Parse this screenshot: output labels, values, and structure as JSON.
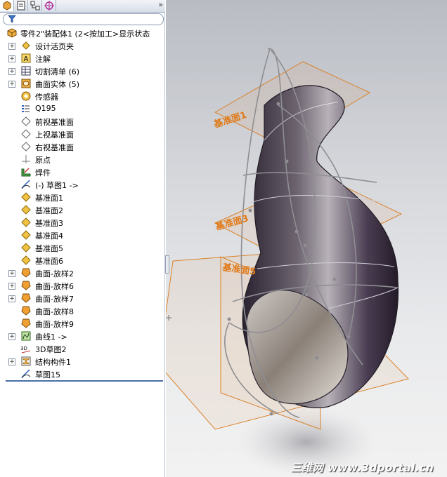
{
  "tabs": [
    "feature-manager-icon",
    "property-manager-icon",
    "configuration-manager-icon",
    "dimxpert-icon"
  ],
  "tab_more": "»",
  "tree": {
    "root_label": "零件2\"装配体1    (2<按加工>显示状态",
    "items": [
      {
        "label": "设计活页夹",
        "icon": "design-binder-icon",
        "expandable": true
      },
      {
        "label": "注解",
        "icon": "annotations-icon",
        "expandable": true
      },
      {
        "label": "切割清单 (6)",
        "icon": "cut-list-icon",
        "expandable": true
      },
      {
        "label": "曲面实体 (5)",
        "icon": "surface-bodies-icon",
        "expandable": true
      },
      {
        "label": "传感器",
        "icon": "sensor-icon",
        "expandable": false
      },
      {
        "label": "Q195",
        "icon": "material-icon",
        "expandable": false
      },
      {
        "label": "前视基准面",
        "icon": "plane-icon",
        "expandable": false
      },
      {
        "label": "上视基准面",
        "icon": "plane-icon",
        "expandable": false
      },
      {
        "label": "右视基准面",
        "icon": "plane-icon",
        "expandable": false
      },
      {
        "label": "原点",
        "icon": "origin-icon",
        "expandable": false
      },
      {
        "label": "焊件",
        "icon": "weldment-icon",
        "expandable": false
      },
      {
        "label": "(-) 草图1 ->",
        "icon": "sketch-icon",
        "expandable": false
      },
      {
        "label": "基准面1",
        "icon": "ref-plane-icon",
        "expandable": false
      },
      {
        "label": "基准面2",
        "icon": "ref-plane-icon",
        "expandable": false
      },
      {
        "label": "基准面3",
        "icon": "ref-plane-icon",
        "expandable": false
      },
      {
        "label": "基准面4",
        "icon": "ref-plane-icon",
        "expandable": false
      },
      {
        "label": "基准面5",
        "icon": "ref-plane-icon",
        "expandable": false
      },
      {
        "label": "基准面6",
        "icon": "ref-plane-icon",
        "expandable": false
      },
      {
        "label": "曲面-放样2",
        "icon": "loft-icon",
        "expandable": true
      },
      {
        "label": "曲面-放样6",
        "icon": "loft-icon",
        "expandable": true
      },
      {
        "label": "曲面-放样7",
        "icon": "loft-icon",
        "expandable": true
      },
      {
        "label": "曲面-放样8",
        "icon": "loft-icon",
        "expandable": false
      },
      {
        "label": "曲面-放样9",
        "icon": "loft-icon",
        "expandable": false
      },
      {
        "label": "曲线1 ->",
        "icon": "curve-icon",
        "expandable": true
      },
      {
        "label": "3D草图2",
        "icon": "3d-sketch-icon",
        "expandable": false
      },
      {
        "label": "结构构件1",
        "icon": "structural-member-icon",
        "expandable": true
      },
      {
        "label": "草图15",
        "icon": "sketch-icon",
        "expandable": false
      }
    ]
  },
  "viewport": {
    "plane_labels": [
      "基准面1",
      "基准面3",
      "基准面5"
    ],
    "watermark": "三维网 www.3dportal.cn"
  },
  "colors": {
    "plane": "#d9822b",
    "surface": "#4a3d4f",
    "tree_bg": "#ffffff",
    "accent": "#4a6fa8"
  }
}
